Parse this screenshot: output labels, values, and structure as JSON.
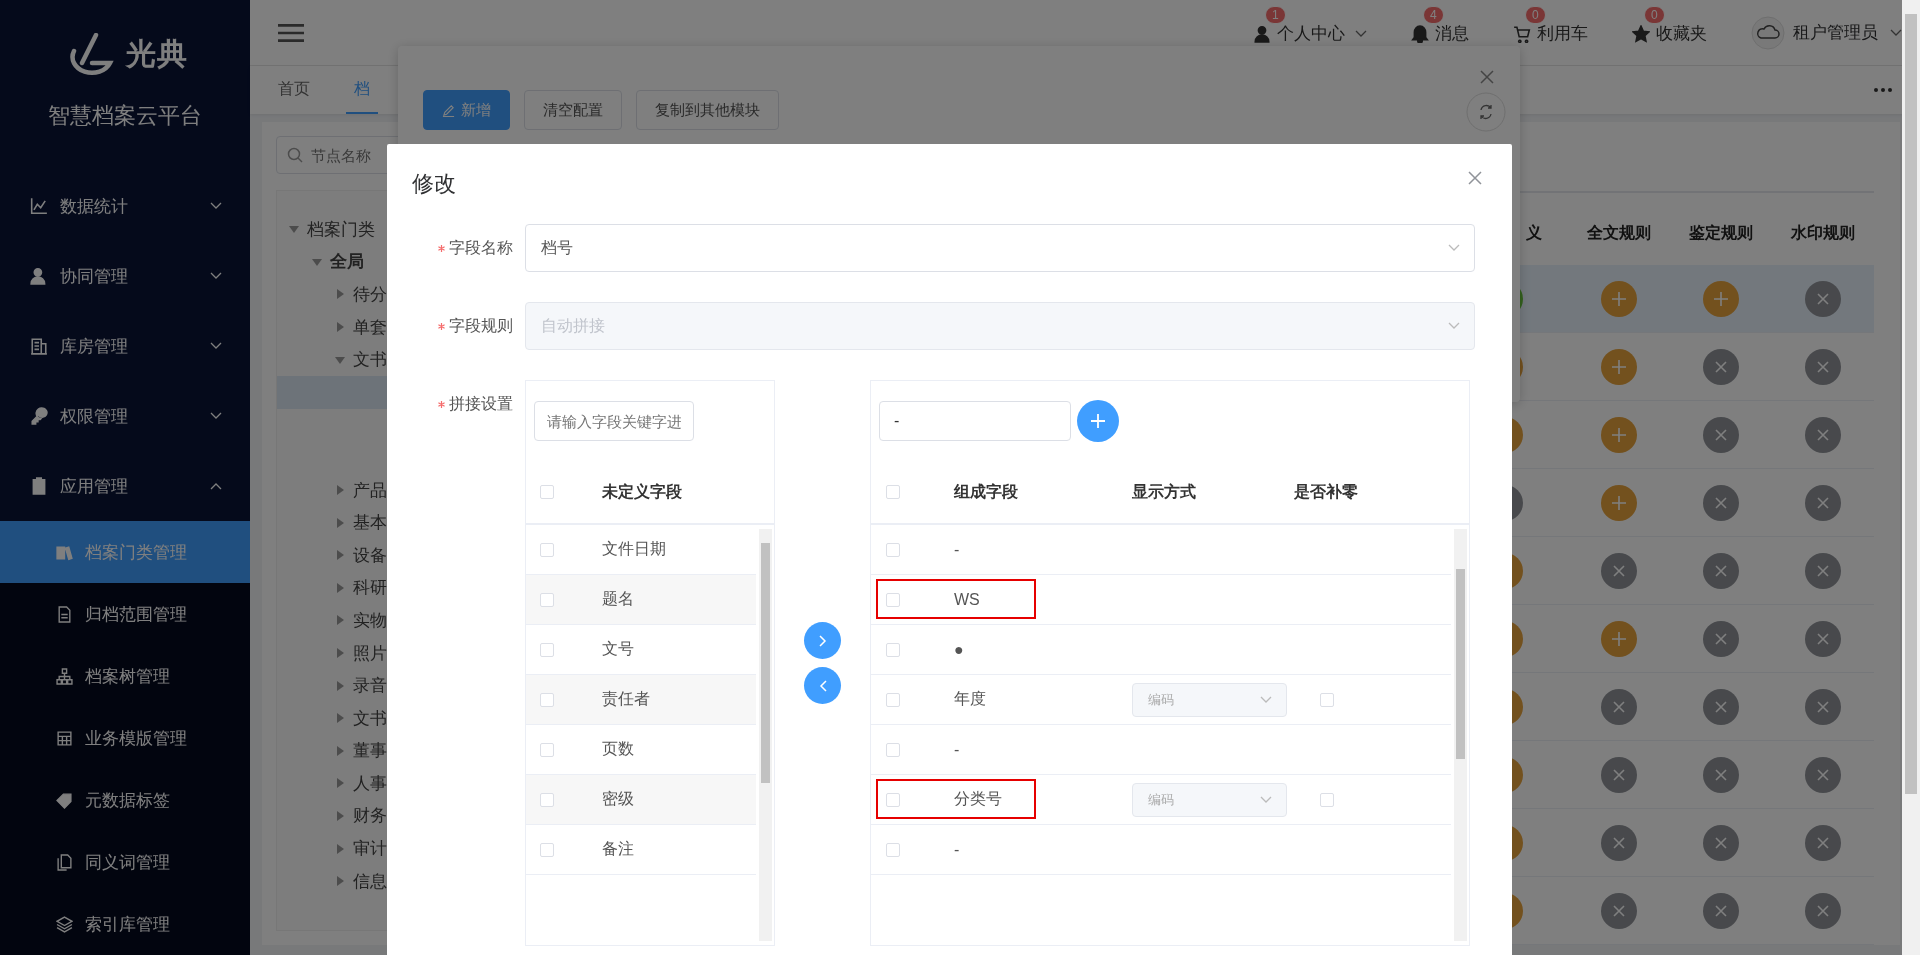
{
  "sidebar": {
    "logo_text": "光典",
    "title": "智慧档案云平台",
    "items": [
      {
        "label": "数据统计",
        "expanded": false
      },
      {
        "label": "协同管理",
        "expanded": false
      },
      {
        "label": "库房管理",
        "expanded": false
      },
      {
        "label": "权限管理",
        "expanded": false
      },
      {
        "label": "应用管理",
        "expanded": true,
        "children": [
          {
            "label": "档案门类管理",
            "selected": true
          },
          {
            "label": "归档范围管理",
            "selected": false
          },
          {
            "label": "档案树管理",
            "selected": false
          },
          {
            "label": "业务模版管理",
            "selected": false
          },
          {
            "label": "元数据标签",
            "selected": false
          },
          {
            "label": "同义词管理",
            "selected": false
          },
          {
            "label": "索引库管理",
            "selected": false
          }
        ]
      }
    ]
  },
  "header": {
    "items": [
      {
        "label": "个人中心",
        "badge": "1"
      },
      {
        "label": "消息",
        "badge": "4"
      },
      {
        "label": "利用车",
        "badge": "0"
      },
      {
        "label": "收藏夹",
        "badge": "0"
      }
    ],
    "user": "租户管理员"
  },
  "tabs": [
    {
      "label": "首页",
      "selected": false
    },
    {
      "label": "档",
      "selected": true
    }
  ],
  "tree": {
    "search_placeholder": "节点名称",
    "nodes": [
      {
        "label": "档案门类",
        "selected": false,
        "expanded": true,
        "children": [
          {
            "label": "全局",
            "selected": false,
            "expanded": true,
            "children": [
              {
                "label": "待分",
                "selected": false,
                "expanded": false
              },
              {
                "label": "单套",
                "selected": false,
                "expanded": false
              },
              {
                "label": "文书",
                "selected": false,
                "expanded": true,
                "children": [
                  {
                    "selected": true
                  },
                  {
                    "selected": false
                  },
                  {
                    "selected": false
                  }
                ]
              },
              {
                "label": "产品",
                "selected": false,
                "expanded": false
              },
              {
                "label": "基本",
                "selected": false,
                "expanded": false
              },
              {
                "label": "设备",
                "selected": false,
                "expanded": false
              },
              {
                "label": "科研",
                "selected": false,
                "expanded": false
              },
              {
                "label": "实物",
                "selected": false,
                "expanded": false
              },
              {
                "label": "照片",
                "selected": false,
                "expanded": false
              },
              {
                "label": "录音",
                "selected": false,
                "expanded": false
              },
              {
                "label": "文书",
                "selected": false,
                "expanded": false
              },
              {
                "label": "董事",
                "selected": false,
                "expanded": false
              },
              {
                "label": "人事",
                "selected": false,
                "expanded": false
              },
              {
                "label": "财务",
                "selected": false,
                "expanded": false
              },
              {
                "label": "审计",
                "selected": false,
                "expanded": false
              },
              {
                "label": "信息",
                "selected": false,
                "expanded": false
              }
            ]
          }
        ]
      }
    ]
  },
  "table": {
    "columns": [
      "义",
      "全文规则",
      "鉴定规则",
      "水印规则"
    ],
    "rows": [
      {
        "selected": true,
        "cells": [
          {
            "kind": "on"
          },
          {
            "kind": "add"
          },
          {
            "kind": "add"
          },
          {
            "kind": "none"
          }
        ]
      },
      {
        "selected": false,
        "cells": [
          {
            "kind": "add"
          },
          {
            "kind": "add"
          },
          {
            "kind": "none"
          },
          {
            "kind": "none"
          }
        ]
      },
      {
        "selected": false,
        "cells": [
          {
            "kind": "add"
          },
          {
            "kind": "add"
          },
          {
            "kind": "none"
          },
          {
            "kind": "none"
          }
        ]
      },
      {
        "selected": false,
        "cells": [
          {
            "kind": "none"
          },
          {
            "kind": "add"
          },
          {
            "kind": "none"
          },
          {
            "kind": "none"
          }
        ]
      },
      {
        "selected": false,
        "cells": [
          {
            "kind": "add"
          },
          {
            "kind": "none"
          },
          {
            "kind": "none"
          },
          {
            "kind": "none"
          }
        ]
      },
      {
        "selected": false,
        "cells": [
          {
            "kind": "add"
          },
          {
            "kind": "add"
          },
          {
            "kind": "none"
          },
          {
            "kind": "none"
          }
        ]
      },
      {
        "selected": false,
        "cells": [
          {
            "kind": "add"
          },
          {
            "kind": "none"
          },
          {
            "kind": "none"
          },
          {
            "kind": "none"
          }
        ]
      },
      {
        "selected": false,
        "cells": [
          {
            "kind": "add"
          },
          {
            "kind": "none"
          },
          {
            "kind": "none"
          },
          {
            "kind": "none"
          }
        ]
      },
      {
        "selected": false,
        "cells": [
          {
            "kind": "add"
          },
          {
            "kind": "none"
          },
          {
            "kind": "none"
          },
          {
            "kind": "none"
          }
        ]
      },
      {
        "selected": false,
        "cells": [
          {
            "kind": "add"
          },
          {
            "kind": "none"
          },
          {
            "kind": "none"
          },
          {
            "kind": "none"
          }
        ]
      }
    ]
  },
  "back_dialog": {
    "buttons": [
      {
        "label": "新增",
        "kind": "primary"
      },
      {
        "label": "清空配置",
        "kind": "plain"
      },
      {
        "label": "复制到其他模块",
        "kind": "plain"
      }
    ]
  },
  "modal": {
    "title": "修改",
    "fields": [
      {
        "label": "字段名称",
        "required": true,
        "value": "档号",
        "disabled": false
      },
      {
        "label": "字段规则",
        "required": true,
        "value": "自动拼接",
        "disabled": true
      }
    ],
    "transfer_label": "拼接设置",
    "transfer_required": true,
    "left": {
      "search_placeholder": "请输入字段关键字进",
      "all_checked": false,
      "title": "未定义字段",
      "items": [
        {
          "label": "文件日期",
          "checked": false
        },
        {
          "label": "题名",
          "checked": false
        },
        {
          "label": "文号",
          "checked": false
        },
        {
          "label": "责任者",
          "checked": false
        },
        {
          "label": "页数",
          "checked": false
        },
        {
          "label": "密级",
          "checked": false
        },
        {
          "label": "备注",
          "checked": false
        }
      ]
    },
    "right": {
      "separator_value": "-",
      "all_checked": false,
      "columns": [
        "组成字段",
        "显示方式",
        "是否补零"
      ],
      "rows": [
        {
          "label": "-",
          "checked": false,
          "highlighted": false
        },
        {
          "label": "WS",
          "checked": false,
          "highlighted": true
        },
        {
          "label": "●",
          "checked": false,
          "highlighted": false
        },
        {
          "label": "年度",
          "checked": false,
          "highlighted": false,
          "display_mode": "编码",
          "zero_pad": false
        },
        {
          "label": "-",
          "checked": false,
          "highlighted": false
        },
        {
          "label": "分类号",
          "checked": false,
          "highlighted": true,
          "display_mode": "编码",
          "zero_pad": false
        },
        {
          "label": "-",
          "checked": false,
          "highlighted": false
        }
      ]
    }
  }
}
